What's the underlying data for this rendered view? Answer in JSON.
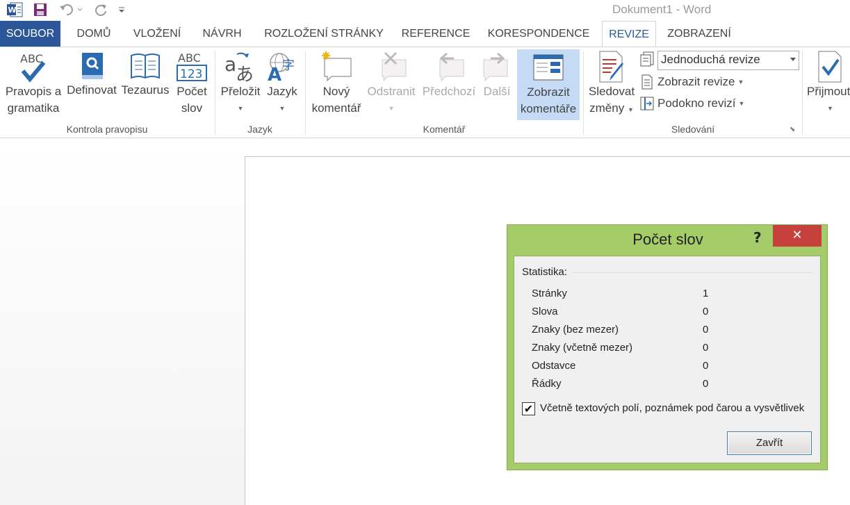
{
  "window": {
    "title": "Dokument1 - Word"
  },
  "tabs": [
    "SOUBOR",
    "DOMŮ",
    "VLOŽENÍ",
    "NÁVRH",
    "ROZLOŽENÍ STRÁNKY",
    "REFERENCE",
    "KORESPONDENCE",
    "REVIZE",
    "ZOBRAZENÍ"
  ],
  "ribbon": {
    "proofing": {
      "spelling": [
        "Pravopis a",
        "gramatika"
      ],
      "define": "Definovat",
      "thesaurus": "Tezaurus",
      "wordcount": [
        "Počet",
        "slov"
      ],
      "group": "Kontrola pravopisu"
    },
    "language": {
      "translate": "Přeložit",
      "language": "Jazyk",
      "group": "Jazyk"
    },
    "comments": {
      "new": [
        "Nový",
        "komentář"
      ],
      "delete": "Odstranit",
      "previous": "Předchozí",
      "next": "Další",
      "show": [
        "Zobrazit",
        "komentáře"
      ],
      "group": "Komentář"
    },
    "tracking": {
      "track": [
        "Sledovat",
        "změny"
      ],
      "display_combo": "Jednoduchá revize",
      "show_markup": "Zobrazit revize",
      "reviewing_pane": "Podokno revizí",
      "group": "Sledování"
    },
    "changes": {
      "accept": "Přijmout"
    },
    "abc_text": "ABC",
    "num_text": "123"
  },
  "dialog": {
    "title": "Počet slov",
    "help": "?",
    "close": "✕",
    "section": "Statistika:",
    "rows": [
      {
        "label": "Stránky",
        "value": "1"
      },
      {
        "label": "Slova",
        "value": "0"
      },
      {
        "label": "Znaky (bez mezer)",
        "value": "0"
      },
      {
        "label": "Znaky (včetně mezer)",
        "value": "0"
      },
      {
        "label": "Odstavce",
        "value": "0"
      },
      {
        "label": "Řádky",
        "value": "0"
      }
    ],
    "checkbox_label": "Včetně textových polí, poznámek pod čarou a vysvětlivek",
    "checkbox_checked": "✔",
    "close_button": "Zavřít"
  }
}
